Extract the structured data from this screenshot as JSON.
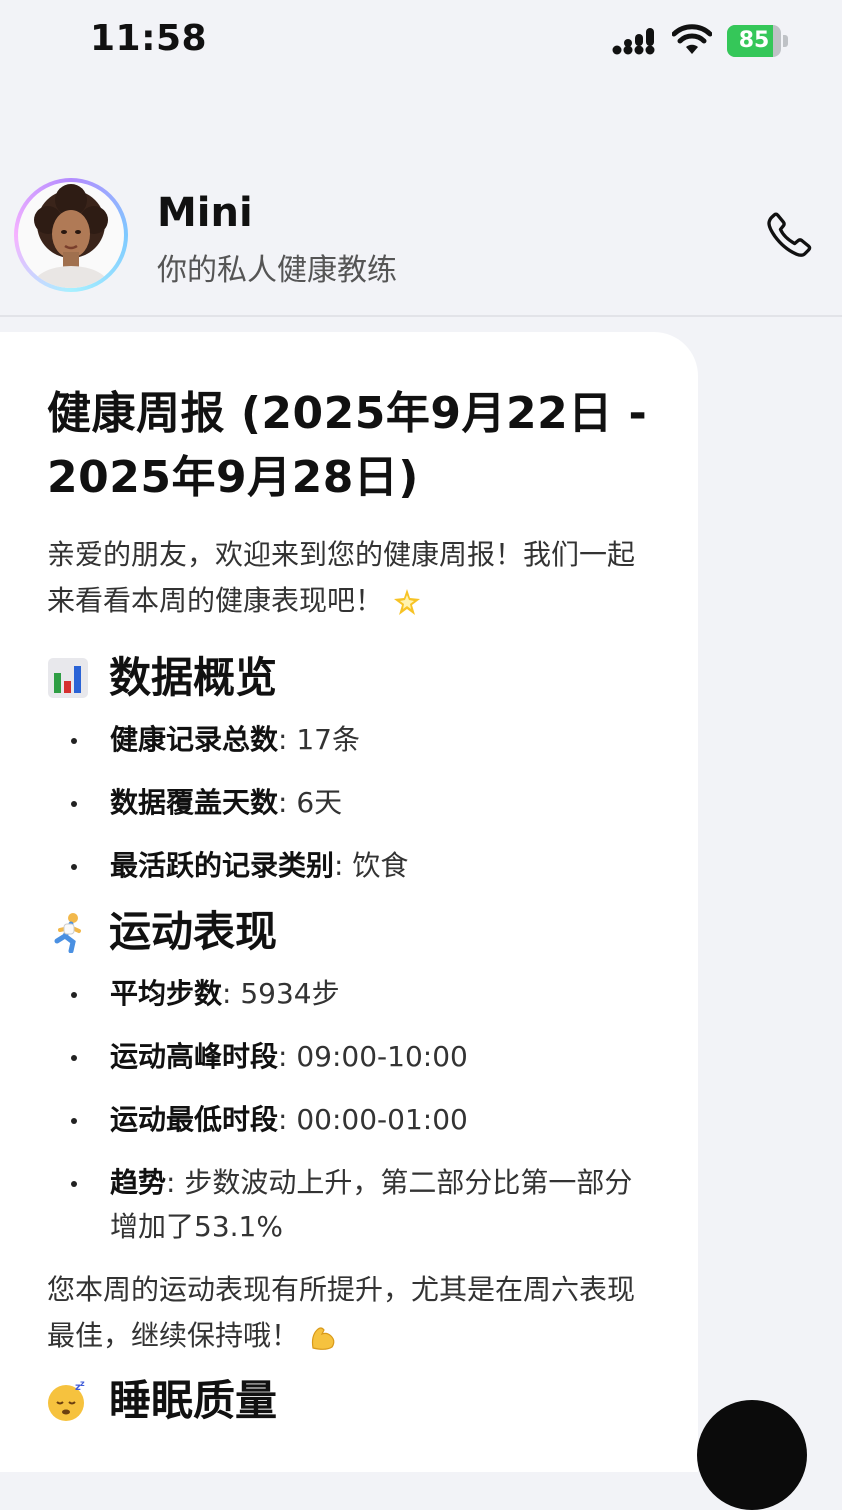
{
  "status_bar": {
    "time": "11:58",
    "battery_level": "85",
    "battery_percent": 85
  },
  "header": {
    "name": "Mini",
    "subtitle": "你的私人健康教练"
  },
  "message": {
    "title": "健康周报 (2025年9月22日 - 2025年9月28日)",
    "intro": "亲爱的朋友，欢迎来到您的健康周报！我们一起来看看本周的健康表现吧！",
    "sections": [
      {
        "heading": "数据概览",
        "items": [
          {
            "label": "健康记录总数",
            "value": ": 17条"
          },
          {
            "label": "数据覆盖天数",
            "value": ": 6天"
          },
          {
            "label": "最活跃的记录类别",
            "value": ": 饮食"
          }
        ]
      },
      {
        "heading": "运动表现",
        "items": [
          {
            "label": "平均步数",
            "value": ": 5934步"
          },
          {
            "label": "运动高峰时段",
            "value": ": 09:00-10:00"
          },
          {
            "label": "运动最低时段",
            "value": ": 00:00-01:00"
          },
          {
            "label": "趋势",
            "value": ": 步数波动上升，第二部分比第一部分增加了53.1%"
          }
        ],
        "summary": "您本周的运动表现有所提升，尤其是在周六表现最佳，继续保持哦！"
      },
      {
        "heading": "睡眠质量"
      }
    ]
  },
  "icons": {
    "status": [
      "signal-icon",
      "wifi-icon",
      "battery-icon"
    ],
    "header": [
      "avatar",
      "phone-icon"
    ],
    "emoji": [
      "sparkle-emoji-icon",
      "bar-chart-emoji-icon",
      "runner-emoji-icon",
      "flexed-biceps-emoji-icon",
      "sleeping-face-emoji-icon"
    ]
  }
}
